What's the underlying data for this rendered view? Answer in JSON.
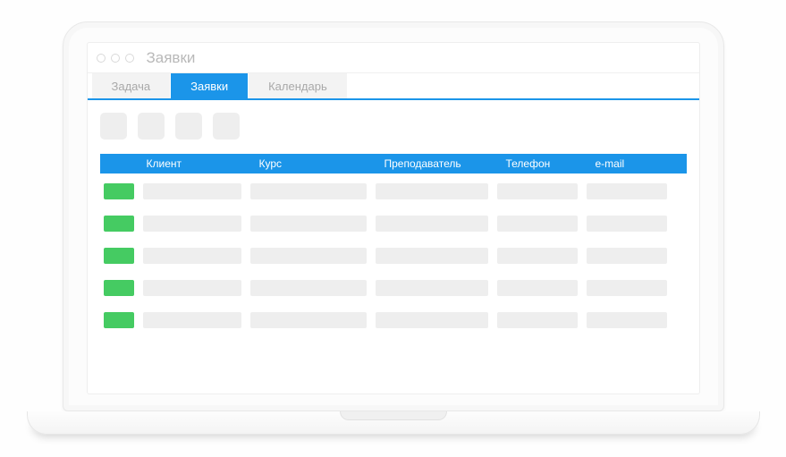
{
  "window": {
    "title": "Заявки"
  },
  "tabs": [
    {
      "label": "Задача",
      "active": false
    },
    {
      "label": "Заявки",
      "active": true
    },
    {
      "label": "Календарь",
      "active": false
    }
  ],
  "toolbar": {
    "buttons": 4
  },
  "table": {
    "headers": {
      "client": "Клиент",
      "course": "Курс",
      "teacher": "Преподаватель",
      "phone": "Телефон",
      "email": "e-mail"
    },
    "row_count": 5,
    "colors": {
      "status_ok": "#45cb62",
      "header_bg": "#1b95e9",
      "placeholder": "#eeeeee"
    }
  }
}
